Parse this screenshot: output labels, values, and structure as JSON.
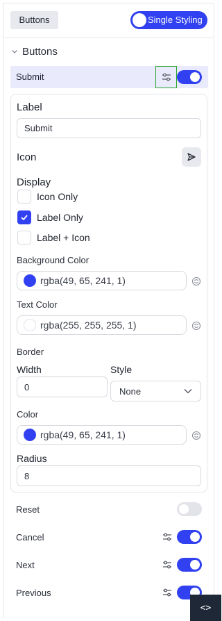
{
  "header": {
    "tab_label": "Buttons",
    "styling_toggle_label": "Single Styling"
  },
  "section": {
    "title": "Buttons"
  },
  "selected_item": {
    "label": "Submit",
    "enabled": true
  },
  "panel": {
    "label_heading": "Label",
    "label_value": "Submit",
    "icon_heading": "Icon",
    "icon_name": "send-icon",
    "display_heading": "Display",
    "display_options": [
      {
        "label": "Icon Only",
        "checked": false
      },
      {
        "label": "Label Only",
        "checked": true
      },
      {
        "label": "Label + Icon",
        "checked": false
      }
    ],
    "background_color_heading": "Background Color",
    "background_color_value": "rgba(49, 65, 241, 1)",
    "background_swatch": "#3141f1",
    "text_color_heading": "Text Color",
    "text_color_value": "rgba(255, 255, 255, 1)",
    "text_swatch": "#ffffff",
    "border_heading": "Border",
    "width_heading": "Width",
    "width_value": "0",
    "style_heading": "Style",
    "style_value": "None",
    "color_heading": "Color",
    "border_color_value": "rgba(49, 65, 241, 1)",
    "border_swatch": "#3141f1",
    "radius_heading": "Radius",
    "radius_value": "8"
  },
  "items": [
    {
      "label": "Reset",
      "enabled": false,
      "has_settings": false
    },
    {
      "label": "Cancel",
      "enabled": true,
      "has_settings": true
    },
    {
      "label": "Next",
      "enabled": true,
      "has_settings": true
    },
    {
      "label": "Previous",
      "enabled": true,
      "has_settings": true
    }
  ],
  "footer": {
    "code_toggle_label": "<>"
  },
  "colors": {
    "accent": "#3141f1",
    "selected_row_bg": "#e9eafb",
    "highlight_border": "#29a52a"
  }
}
